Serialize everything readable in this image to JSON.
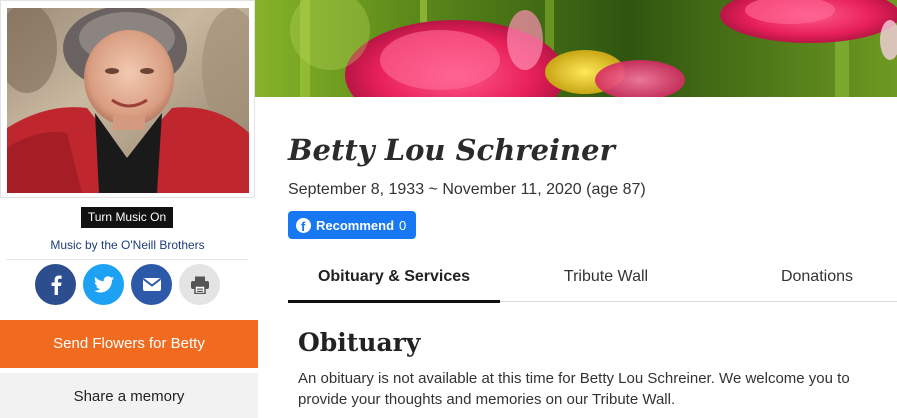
{
  "memorial": {
    "name": "Betty Lou Schreiner",
    "dates": "September 8, 1933 ~ November 11, 2020 (age 87)"
  },
  "facebook": {
    "recommend_label": "Recommend",
    "recommend_count": "0"
  },
  "music": {
    "toggle_label": "Turn Music On",
    "credit": "Music by the O'Neill Brothers"
  },
  "share": {
    "buttons": [
      {
        "icon": "facebook-icon",
        "color": "#2d4e8e"
      },
      {
        "icon": "twitter-icon",
        "color": "#1da1f2"
      },
      {
        "icon": "email-icon",
        "color": "#2d5aa8"
      },
      {
        "icon": "print-icon",
        "color": "#e4e4e4"
      }
    ]
  },
  "actions": {
    "send_flowers": "Send Flowers for Betty",
    "share_memory": "Share a memory"
  },
  "tabs": [
    {
      "label": "Obituary & Services",
      "active": true
    },
    {
      "label": "Tribute Wall",
      "active": false
    },
    {
      "label": "Donations",
      "active": false
    }
  ],
  "obituary": {
    "heading": "Obituary",
    "text": "An obituary is not available at this time for Betty Lou Schreiner. We welcome you to provide your thoughts and memories on our Tribute Wall."
  },
  "colors": {
    "flowers_button": "#f06a1f",
    "memory_button": "#f2f2f2",
    "recommend_button": "#1877f2",
    "music_button": "#111111"
  }
}
